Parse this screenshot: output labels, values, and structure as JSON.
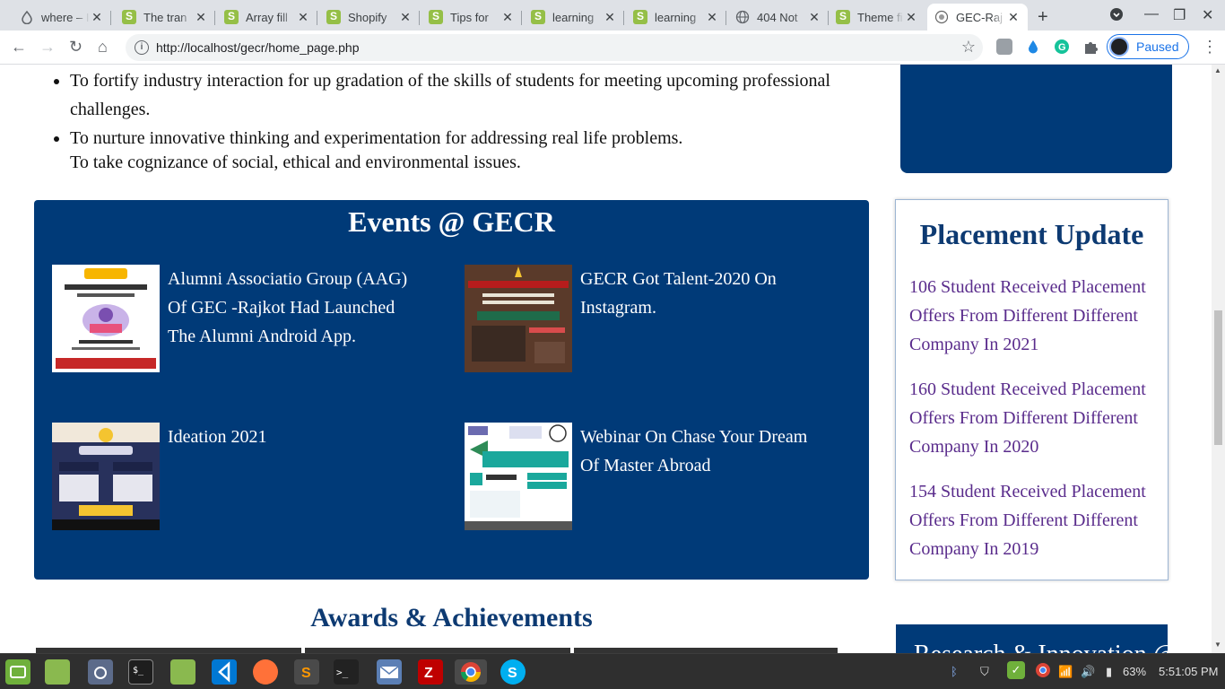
{
  "browser": {
    "tabs": [
      {
        "title": "where – I",
        "icon": "drop-icon"
      },
      {
        "title": "The tran",
        "icon": "shopify-icon"
      },
      {
        "title": "Array fill",
        "icon": "shopify-icon"
      },
      {
        "title": "Shopify",
        "icon": "shopify-icon"
      },
      {
        "title": "Tips for",
        "icon": "shopify-icon"
      },
      {
        "title": "learning",
        "icon": "shopify-icon"
      },
      {
        "title": "learning",
        "icon": "shopify-icon"
      },
      {
        "title": "404 Not",
        "icon": "globe-icon"
      },
      {
        "title": "Theme fi",
        "icon": "shopify-icon"
      },
      {
        "title": "GEC-Raj",
        "icon": "site-icon",
        "active": true
      }
    ],
    "url": "http://localhost/gecr/home_page.php",
    "profile_label": "Paused",
    "accent": "#1a73e8"
  },
  "page": {
    "objectives": [
      "To fortify industry interaction for up gradation of the skills of students for meeting upcoming professional challenges.",
      "To nurture innovative thinking and experimentation for addressing real life problems."
    ],
    "objective_extra": "To take cognizance of social, ethical and environmental issues.",
    "events": {
      "title": "Events @ GECR",
      "items": [
        {
          "text": "Alumni Associatio Group (AAG) Of GEC -Rajkot Had Launched The Alumni Android App.",
          "image": "alumni-app-poster"
        },
        {
          "text": "GECR Got Talent-2020 On Instagram.",
          "image": "gecr-got-talent-poster"
        },
        {
          "text": "Ideation 2021",
          "image": "ideation-poster"
        },
        {
          "text": "Webinar On Chase Your Dream Of Master Abroad",
          "image": "webinar-poster"
        }
      ]
    },
    "placement": {
      "title": "Placement Update",
      "items": [
        "106 Student Received Placement Offers From Different Different Company In 2021",
        "160 Student Received Placement Offers From Different Different Company In 2020",
        "154 Student Received Placement Offers From Different Different Company In 2019"
      ]
    },
    "awards_title": "Awards & Achievements",
    "research_title": "Research & Innovation @",
    "colors": {
      "primary": "#003a78",
      "heading": "#0d3a72",
      "link": "#5a2c8c"
    }
  },
  "taskbar": {
    "battery": "63%",
    "clock": "5:51:05 PM"
  }
}
